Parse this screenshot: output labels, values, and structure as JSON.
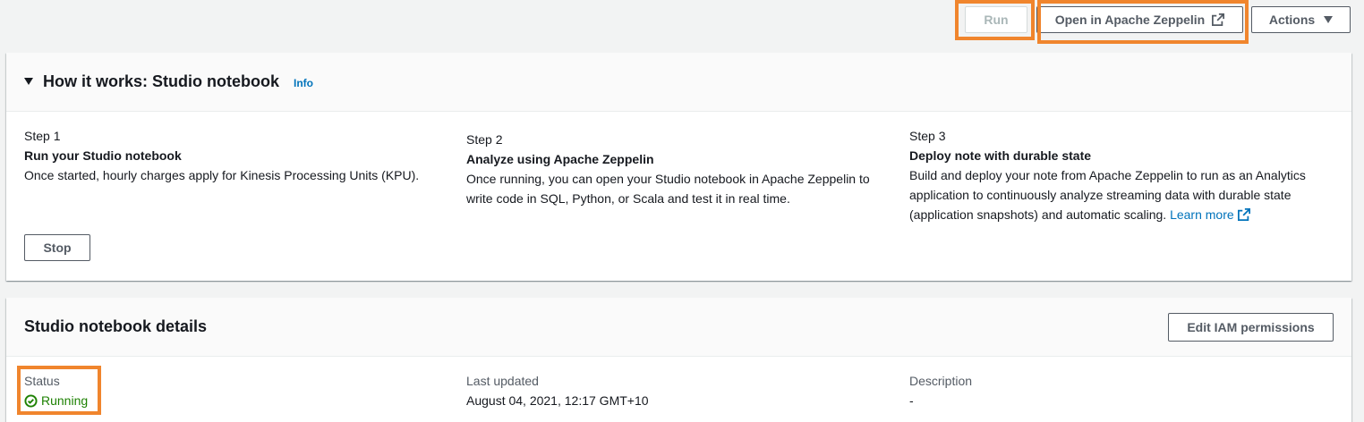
{
  "toolbar": {
    "run_label": "Run",
    "open_zeppelin_label": "Open in Apache Zeppelin",
    "actions_label": "Actions"
  },
  "how_it_works": {
    "title": "How it works: Studio notebook",
    "info_label": "Info",
    "steps": [
      {
        "number": "Step 1",
        "title": "Run your Studio notebook",
        "description": "Once started, hourly charges apply for Kinesis Processing Units (KPU)."
      },
      {
        "number": "Step 2",
        "title": "Analyze using Apache Zeppelin",
        "description": "Once running, you can open your Studio notebook in Apache Zeppelin to write code in SQL, Python, or Scala and test it in real time."
      },
      {
        "number": "Step 3",
        "title": "Deploy note with durable state",
        "description": "Build and deploy your note from Apache Zeppelin to run as an Analytics application to continuously analyze streaming data with durable state (application snapshots) and automatic scaling.",
        "learn_more_label": "Learn more"
      }
    ],
    "stop_label": "Stop"
  },
  "details": {
    "title": "Studio notebook details",
    "edit_iam_label": "Edit IAM permissions",
    "status_label": "Status",
    "status_value": "Running",
    "last_updated_label": "Last updated",
    "last_updated_value": "August 04, 2021, 12:17 GMT+10",
    "description_label": "Description",
    "description_value": "-"
  },
  "colors": {
    "highlight": "#f0852d",
    "link": "#0073bb",
    "success": "#1d8102"
  }
}
